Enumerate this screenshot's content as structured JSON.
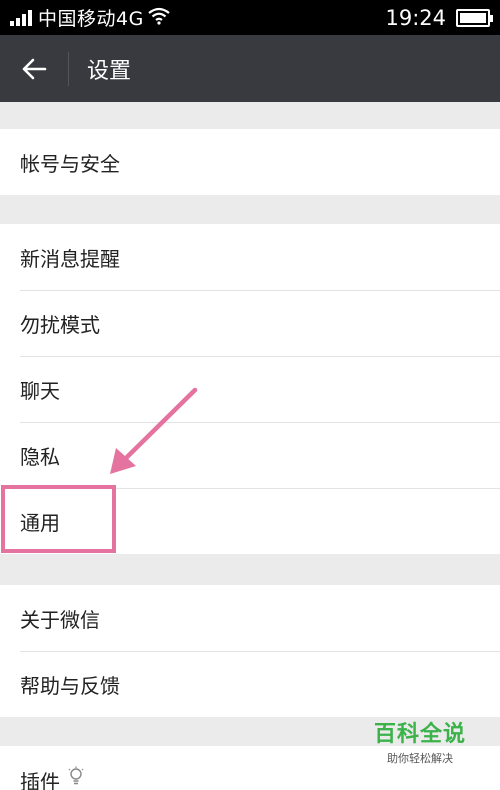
{
  "status_bar": {
    "carrier": "中国移动4G",
    "time": "19:24",
    "battery_level": 1.0
  },
  "header": {
    "title": "设置"
  },
  "groups": [
    {
      "items": [
        {
          "label": "帐号与安全"
        }
      ]
    },
    {
      "items": [
        {
          "label": "新消息提醒"
        },
        {
          "label": "勿扰模式"
        },
        {
          "label": "聊天"
        },
        {
          "label": "隐私"
        },
        {
          "label": "通用"
        }
      ]
    },
    {
      "items": [
        {
          "label": "关于微信"
        },
        {
          "label": "帮助与反馈"
        }
      ]
    },
    {
      "items": [
        {
          "label": "插件",
          "icon": "lightbulb-icon"
        }
      ]
    }
  ],
  "annotation": {
    "color": "#e5739f",
    "target": "通用"
  },
  "watermark": {
    "brand": "百科全说",
    "tagline": "助你轻松解决"
  }
}
